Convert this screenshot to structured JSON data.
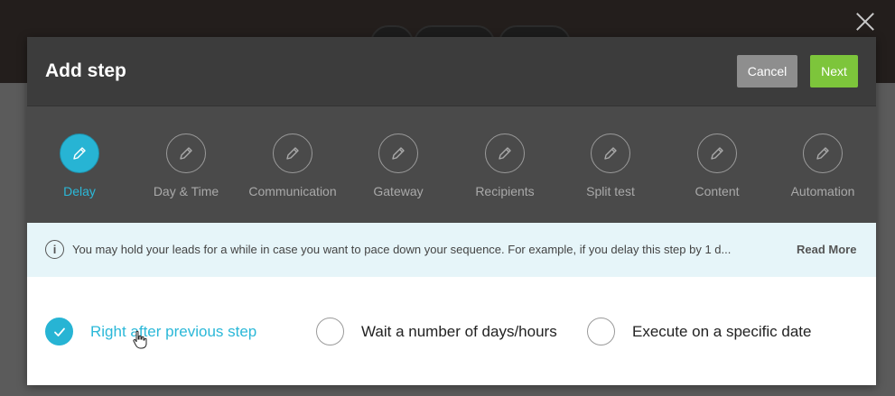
{
  "modal": {
    "title": "Add step",
    "cancel_label": "Cancel",
    "next_label": "Next"
  },
  "steps": [
    {
      "label": "Delay",
      "icon": "pencil-icon",
      "active": true
    },
    {
      "label": "Day & Time",
      "icon": "pencil-icon",
      "active": false
    },
    {
      "label": "Communication",
      "icon": "pencil-icon",
      "active": false
    },
    {
      "label": "Gateway",
      "icon": "pencil-icon",
      "active": false
    },
    {
      "label": "Recipients",
      "icon": "pencil-icon",
      "active": false
    },
    {
      "label": "Split test",
      "icon": "pencil-icon",
      "active": false
    },
    {
      "label": "Content",
      "icon": "pencil-icon",
      "active": false
    },
    {
      "label": "Automation",
      "icon": "pencil-icon",
      "active": false
    }
  ],
  "info": {
    "icon": "info-icon",
    "text": "You may hold your leads for a while in case you want to pace down your sequence. For example, if you delay this step by 1 d...",
    "read_more": "Read More"
  },
  "options": [
    {
      "label": "Right after previous step",
      "checked": true
    },
    {
      "label": "Wait a number of days/hours",
      "checked": false
    },
    {
      "label": "Execute on a specific date",
      "checked": false
    }
  ],
  "colors": {
    "accent": "#27b4d4",
    "next_button": "#7dc53b",
    "cancel_button": "#8e8e8e",
    "header_bg": "#3c3c3c",
    "steps_bg": "#4a4a4a",
    "info_bg": "#e6f5f9"
  }
}
